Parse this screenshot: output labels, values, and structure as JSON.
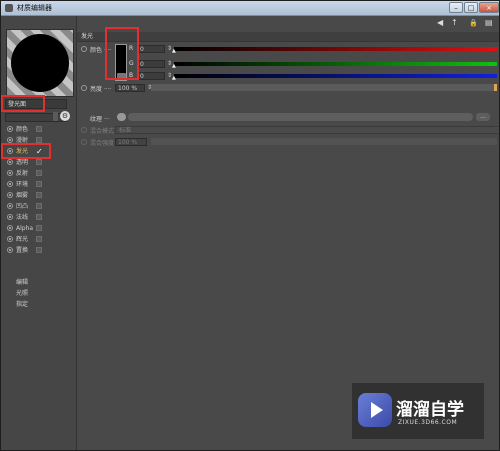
{
  "window": {
    "title": "材质编辑器",
    "minimize": "–",
    "maximize": "□",
    "close": "×"
  },
  "material": {
    "name": "發光面",
    "channel_toggle_icon": "gear-icon"
  },
  "channels": [
    {
      "label": "颜色",
      "checked": false
    },
    {
      "label": "漫射",
      "checked": false
    },
    {
      "label": "发光",
      "checked": true,
      "active": true
    },
    {
      "label": "透明",
      "checked": false
    },
    {
      "label": "反射",
      "checked": false
    },
    {
      "label": "环境",
      "checked": false
    },
    {
      "label": "烟雾",
      "checked": false
    },
    {
      "label": "凹凸",
      "checked": false
    },
    {
      "label": "法线",
      "checked": false
    },
    {
      "label": "Alpha",
      "checked": false
    },
    {
      "label": "辉光",
      "checked": false
    },
    {
      "label": "置换",
      "checked": false
    }
  ],
  "sub_items": [
    "编辑",
    "光照",
    "指定"
  ],
  "checkmark": "✓",
  "nav": {
    "back": "◀",
    "up": "↑",
    "lock": "🔒",
    "menu": "▤"
  },
  "section": {
    "title": "发光"
  },
  "color": {
    "label": "颜色",
    "swatch_color": "#000000",
    "r_label": "R",
    "g_label": "G",
    "b_label": "B",
    "r_value": "0",
    "g_value": "0",
    "b_value": "0",
    "spinner": "⇕",
    "r_color": "#e01010",
    "g_color": "#10c010",
    "b_color": "#1020e0"
  },
  "brightness": {
    "label": "亮度",
    "value": "100 %",
    "fill": 1.0,
    "spinner": "⇕"
  },
  "texture": {
    "label": "纹理",
    "dots": "...",
    "button": "▸",
    "more": "..."
  },
  "mix_mode": {
    "label": "混合模式",
    "value": "标准"
  },
  "mix_strength": {
    "label": "混合强度",
    "value": "100 %"
  },
  "watermark": {
    "title": "溜溜自学",
    "url": "ZIXUE.3D66.COM"
  }
}
